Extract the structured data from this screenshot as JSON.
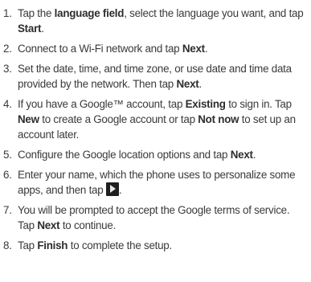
{
  "steps": [
    {
      "num": "1.",
      "parts": [
        {
          "t": "Tap the "
        },
        {
          "t": "language field",
          "b": true
        },
        {
          "t": ", select the language you want, and tap "
        },
        {
          "t": "Start",
          "b": true
        },
        {
          "t": "."
        }
      ]
    },
    {
      "num": "2.",
      "parts": [
        {
          "t": "Connect to a Wi-Fi network and tap "
        },
        {
          "t": "Next",
          "b": true
        },
        {
          "t": "."
        }
      ]
    },
    {
      "num": "3.",
      "parts": [
        {
          "t": "Set the date, time, and time zone, or use date and time data provided by the network. Then tap "
        },
        {
          "t": "Next",
          "b": true
        },
        {
          "t": "."
        }
      ]
    },
    {
      "num": "4.",
      "parts": [
        {
          "t": "If you have a Google™ account, tap "
        },
        {
          "t": "Existing",
          "b": true
        },
        {
          "t": " to sign in. Tap "
        },
        {
          "t": "New",
          "b": true
        },
        {
          "t": " to create a Google account or tap "
        },
        {
          "t": "Not now",
          "b": true
        },
        {
          "t": " to set up an account later."
        }
      ]
    },
    {
      "num": "5.",
      "parts": [
        {
          "t": "Configure the Google location options and tap "
        },
        {
          "t": "Next",
          "b": true
        },
        {
          "t": "."
        }
      ]
    },
    {
      "num": "6.",
      "parts": [
        {
          "t": "Enter your name, which the phone uses to personalize some apps, and then tap "
        },
        {
          "icon": "next-arrow-icon"
        },
        {
          "t": "."
        }
      ]
    },
    {
      "num": "7.",
      "parts": [
        {
          "t": "You will be prompted to accept the Google terms of service. Tap "
        },
        {
          "t": "Next",
          "b": true
        },
        {
          "t": " to continue."
        }
      ]
    },
    {
      "num": "8.",
      "parts": [
        {
          "t": "Tap "
        },
        {
          "t": "Finish",
          "b": true
        },
        {
          "t": " to complete the setup."
        }
      ]
    }
  ]
}
